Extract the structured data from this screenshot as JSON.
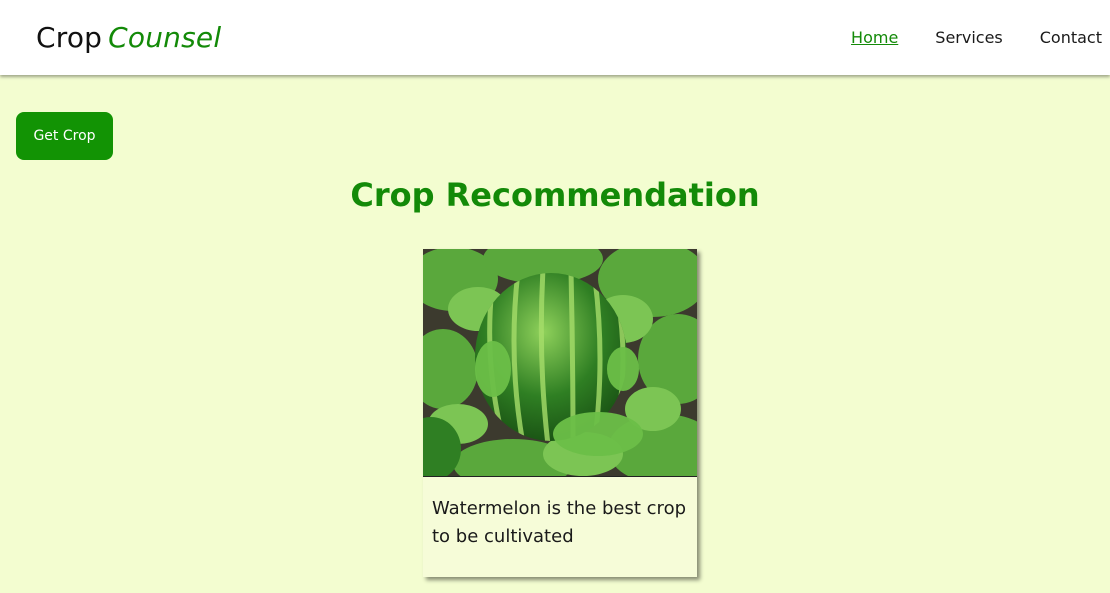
{
  "header": {
    "brand_primary": "Crop",
    "brand_accent": "Counsel",
    "nav": [
      {
        "label": "Home",
        "active": true
      },
      {
        "label": "Services",
        "active": false
      },
      {
        "label": "Contact",
        "active": false
      }
    ]
  },
  "actions": {
    "get_crop_label": "Get Crop"
  },
  "main": {
    "title": "Crop Recommendation",
    "card": {
      "image_icon": "watermelon-photo",
      "text": "Watermelon is the best crop to be cultivated"
    }
  },
  "colors": {
    "background": "#f3fdd0",
    "accent_green": "#138a08",
    "button_green": "#129304",
    "header_bg": "#ffffff"
  }
}
